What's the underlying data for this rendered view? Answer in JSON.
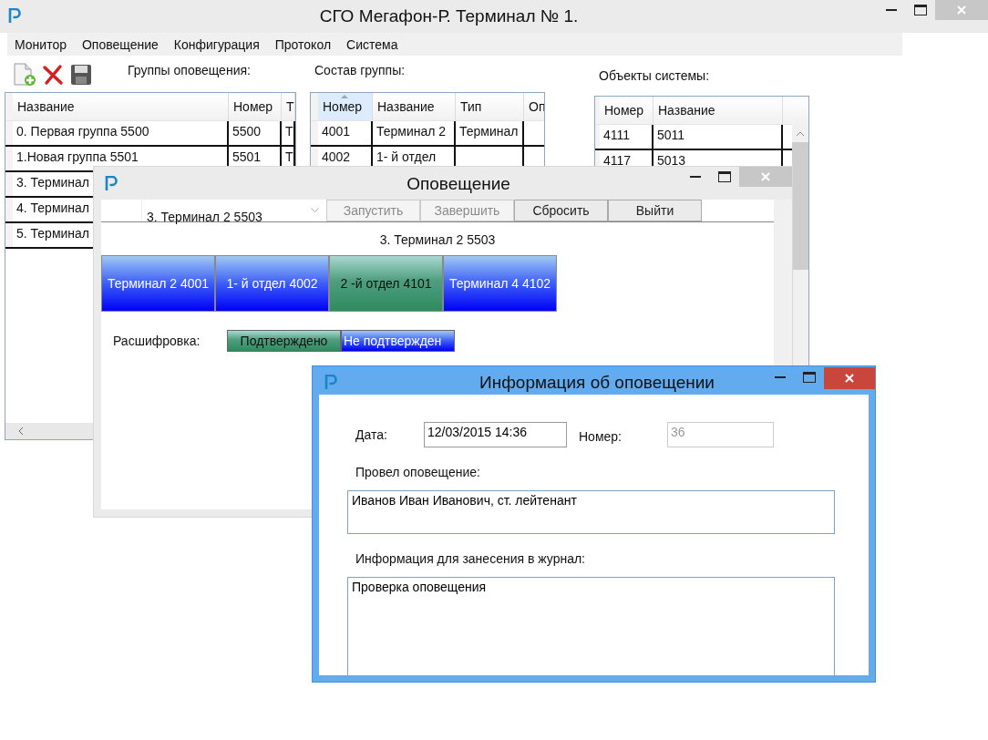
{
  "main_window": {
    "title": "СГО Мегафон-Р. Терминал № 1.",
    "active": false,
    "menu": [
      "Монитор",
      "Оповещение",
      "Конфигурация",
      "Протокол",
      "Система"
    ],
    "panels": [
      {
        "label": "Группы оповещения:",
        "columns": [
          {
            "label": "Название",
            "sorted": false
          },
          {
            "label": "Номер",
            "sorted": false
          },
          {
            "label": "Т",
            "sorted": false
          }
        ],
        "rows": [
          [
            "0. Первая группа 5500",
            "5500",
            "Т"
          ],
          [
            "1.Новая группа 5501",
            "5501",
            "Т"
          ],
          [
            "3. Терминал"
          ],
          [
            "4. Терминал"
          ],
          [
            "5. Терминал"
          ]
        ]
      },
      {
        "label": "Состав группы:",
        "columns": [
          {
            "label": "Номер",
            "sorted": true
          },
          {
            "label": "Название",
            "sorted": false
          },
          {
            "label": "Тип",
            "sorted": false
          },
          {
            "label": "Оп",
            "sorted": false
          }
        ],
        "rows": [
          [
            "4001",
            "Терминал 2",
            "Терминал"
          ],
          [
            "4002",
            "1- й отдел"
          ]
        ]
      },
      {
        "label": "Объекты системы:",
        "columns": [
          {
            "label": "Номер",
            "sorted": false
          },
          {
            "label": "Название",
            "sorted": false
          }
        ],
        "rows": [
          [
            "4111",
            "5011"
          ],
          [
            "4117",
            "5013"
          ]
        ]
      }
    ]
  },
  "alert_window": {
    "title": "Оповещение",
    "active": false,
    "group_select": "3. Терминал 2  5503",
    "buttons": [
      {
        "label": "Запустить",
        "disabled": true
      },
      {
        "label": "Завершить",
        "disabled": true
      },
      {
        "label": "Сбросить",
        "disabled": false
      },
      {
        "label": "Выйти",
        "disabled": false
      }
    ],
    "group_title": "3. Терминал 2  5503",
    "tiles": [
      {
        "label": "Терминал 2 4001",
        "confirmed": false
      },
      {
        "label": "1- й отдел 4002",
        "confirmed": false
      },
      {
        "label": "2 -й отдел 4101",
        "confirmed": true
      },
      {
        "label": "Терминал 4 4102",
        "confirmed": false
      }
    ],
    "legend_label": "Расшифровка:",
    "legend": [
      {
        "label": "Подтверждено",
        "confirmed": true
      },
      {
        "label": "Не подтвержден",
        "confirmed": false
      }
    ]
  },
  "info_window": {
    "title": "Информация об оповещении",
    "active": true,
    "date_label": "Дата:",
    "date": "12/03/2015 14:36",
    "number_label": "Номер:",
    "number": "36",
    "number_disabled": true,
    "operator_label": "Провел оповещение:",
    "operator": "Иванов Иван Иванович, ст. лейтенант",
    "journal_label": "Информация для занесения в журнал:",
    "journal": "Проверка оповещения"
  }
}
